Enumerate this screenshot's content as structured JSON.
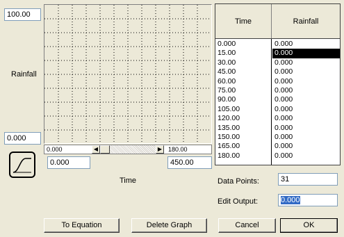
{
  "y_axis": {
    "max": "100.00",
    "min": "0.000",
    "label": "Rainfall"
  },
  "x_axis": {
    "label": "Time",
    "min_field": "0.000",
    "max_field": "450.00",
    "scroll_left": "0.000",
    "scroll_right": "180.00"
  },
  "table": {
    "headers": [
      "Time",
      "Rainfall"
    ],
    "rows": [
      [
        "0.000",
        "0.000"
      ],
      [
        "15.00",
        "0.000"
      ],
      [
        "30.00",
        "0.000"
      ],
      [
        "45.00",
        "0.000"
      ],
      [
        "60.00",
        "0.000"
      ],
      [
        "75.00",
        "0.000"
      ],
      [
        "90.00",
        "0.000"
      ],
      [
        "105.00",
        "0.000"
      ],
      [
        "120.00",
        "0.000"
      ],
      [
        "135.00",
        "0.000"
      ],
      [
        "150.00",
        "0.000"
      ],
      [
        "165.00",
        "0.000"
      ],
      [
        "180.00",
        "0.000"
      ]
    ],
    "selected_row": 1
  },
  "data_points": {
    "label": "Data Points:",
    "value": "31"
  },
  "edit_output": {
    "label": "Edit Output:",
    "value": "0.000"
  },
  "buttons": {
    "to_equation": "To Equation",
    "delete_graph": "Delete Graph",
    "cancel": "Cancel",
    "ok": "OK"
  },
  "icons": {
    "curve": "curve-icon",
    "left": "scroll-left-arrow-icon",
    "right": "scroll-right-arrow-icon"
  }
}
